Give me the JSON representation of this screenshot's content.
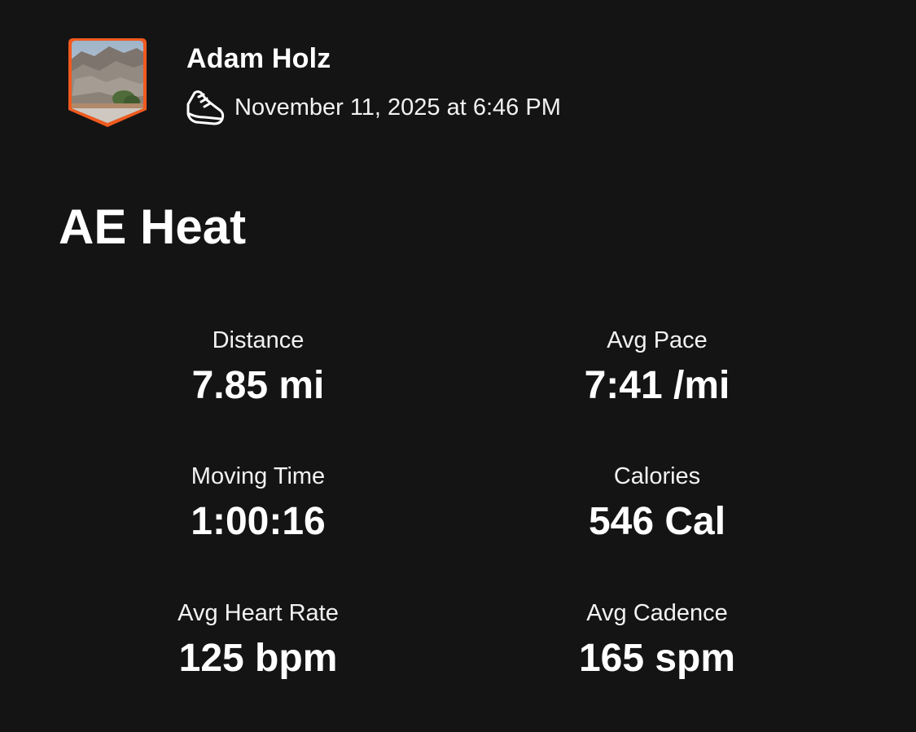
{
  "athlete": {
    "name": "Adam Holz",
    "avatar_icon": "avatar-photo",
    "badge_color": "#f05a1e"
  },
  "activity": {
    "type_icon": "running-shoe-icon",
    "date": "November 11, 2025 at 6:46 PM",
    "title": "AE Heat"
  },
  "stats": [
    {
      "label": "Distance",
      "value": "7.85 mi"
    },
    {
      "label": "Avg Pace",
      "value": "7:41 /mi"
    },
    {
      "label": "Moving Time",
      "value": "1:00:16"
    },
    {
      "label": "Calories",
      "value": "546 Cal"
    },
    {
      "label": "Avg Heart Rate",
      "value": "125 bpm"
    },
    {
      "label": "Avg Cadence",
      "value": "165 spm"
    }
  ],
  "colors": {
    "background": "#141414",
    "text": "#ffffff"
  }
}
